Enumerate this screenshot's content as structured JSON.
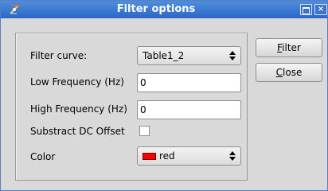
{
  "window": {
    "title": "Filter options",
    "icons": {
      "app": "app-icon",
      "maximize": "maximize-icon",
      "close": "close-icon"
    },
    "close_glyph": "×"
  },
  "form": {
    "filter_curve": {
      "label": "Filter curve:",
      "value": "Table1_2"
    },
    "low_frequency": {
      "label": "Low Frequency (Hz)",
      "value": "0"
    },
    "high_frequency": {
      "label": "High Frequency (Hz)",
      "value": "0"
    },
    "subtract_dc": {
      "label": "Substract DC Offset",
      "checked": false
    },
    "color": {
      "label": "Color",
      "value": "red",
      "swatch": "#ff0000"
    }
  },
  "buttons": {
    "filter": {
      "mnemonic": "F",
      "rest": "ilter"
    },
    "close": {
      "mnemonic": "C",
      "rest": "lose"
    }
  },
  "colors": {
    "titlebar": "#2c67c4",
    "background": "#d9d9d9"
  }
}
